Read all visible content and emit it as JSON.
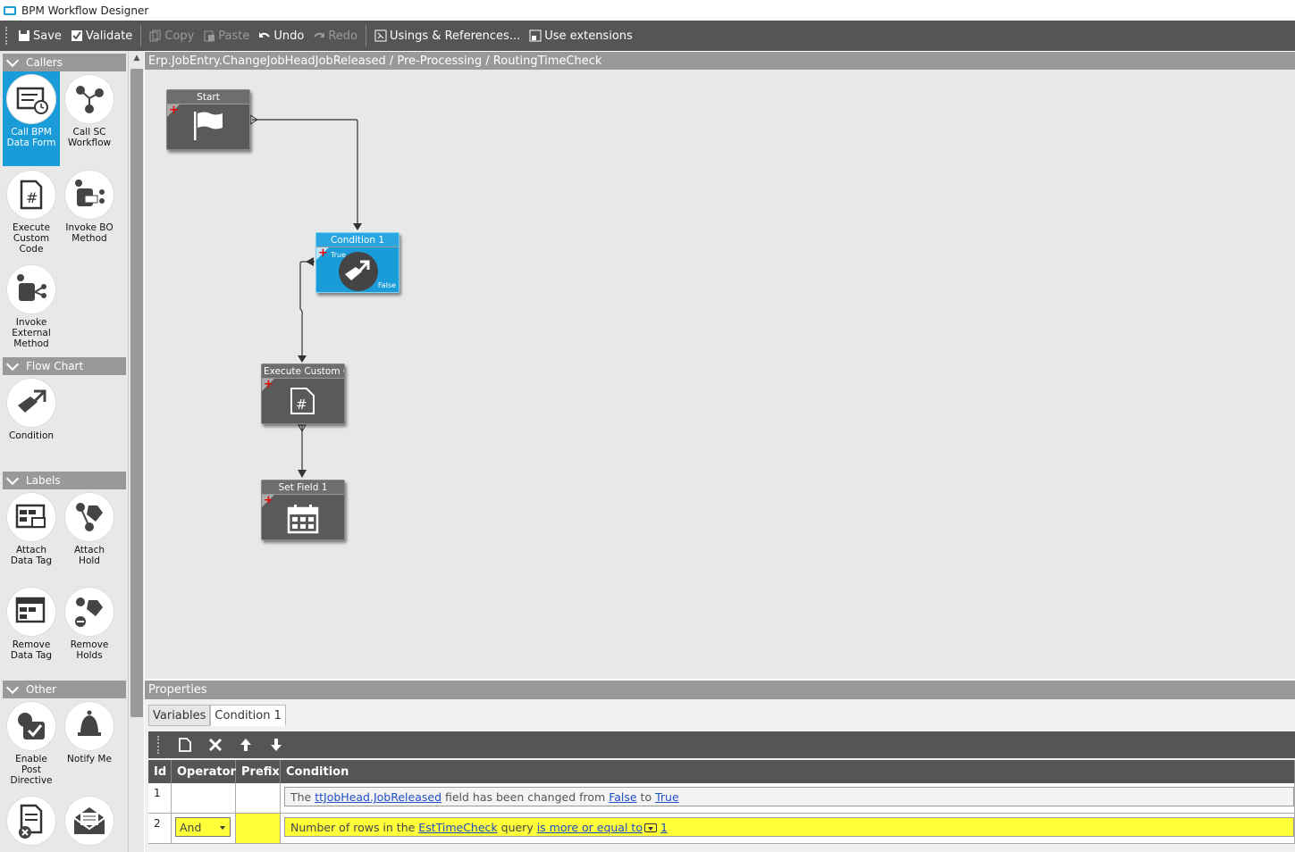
{
  "window": {
    "title": "BPM Workflow Designer"
  },
  "toolbar": {
    "save": "Save",
    "validate": "Validate",
    "copy": "Copy",
    "paste": "Paste",
    "undo": "Undo",
    "redo": "Redo",
    "usings": "Usings & References...",
    "extensions": "Use extensions"
  },
  "palette": {
    "callers": {
      "header": "Callers",
      "items": [
        "Call BPM Data Form",
        "Call SC Workflow",
        "Execute Custom Code",
        "Invoke BO Method",
        "Invoke External Method"
      ]
    },
    "flowchart": {
      "header": "Flow Chart",
      "items": [
        "Condition"
      ]
    },
    "labels": {
      "header": "Labels",
      "items": [
        "Attach Data Tag",
        "Attach Hold",
        "Remove Data Tag",
        "Remove Holds"
      ]
    },
    "other": {
      "header": "Other",
      "items": [
        "Enable Post Directive",
        "Notify Me"
      ]
    }
  },
  "breadcrumb": "Erp.JobEntry.ChangeJobHeadJobReleased / Pre-Processing / RoutingTimeCheck",
  "canvas": {
    "nodes": {
      "start": "Start",
      "condition": "Condition 1",
      "condition_true": "True",
      "condition_false": "False",
      "execute": "Execute Custom Co",
      "setfield": "Set Field 1"
    }
  },
  "properties": {
    "header": "Properties",
    "tabs": [
      "Variables",
      "Condition 1"
    ],
    "columns": [
      "Id",
      "Operator",
      "Prefix",
      "Condition"
    ],
    "rows": [
      {
        "id": "1",
        "operator": "",
        "prefix": "",
        "cond_pre": "The ",
        "cond_link1": "ttJobHead.JobReleased",
        "cond_mid": " field has been changed from ",
        "cond_link2": "False",
        "cond_mid2": " to ",
        "cond_link3": "True"
      },
      {
        "id": "2",
        "operator": "And",
        "prefix": "",
        "cond_pre": "Number of rows in the ",
        "cond_link1": "EstTimeCheck",
        "cond_mid": " query ",
        "cond_link2": "is more or equal to",
        "cond_link3": "1"
      }
    ]
  },
  "colors": {
    "accent": "#1a9cd8",
    "toolbar": "#555555",
    "highlight": "#ffff3a"
  }
}
